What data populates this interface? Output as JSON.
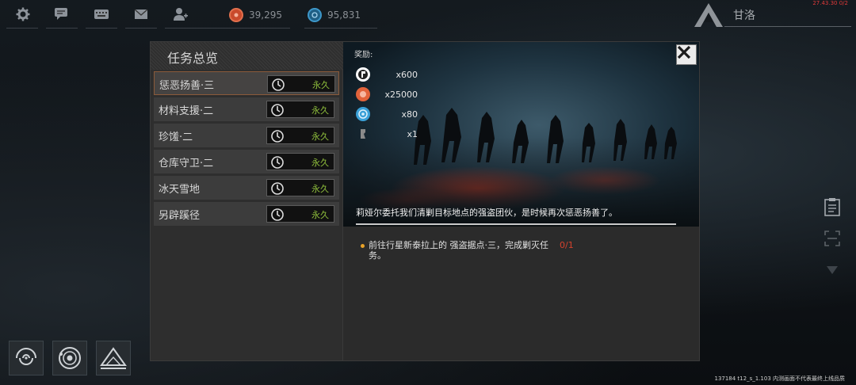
{
  "topbar": {
    "icons": [
      "gear-icon",
      "chat-icon",
      "keyboard-icon",
      "mail-icon",
      "friends-icon"
    ],
    "currency_orange": "39,295",
    "currency_blue": "95,831",
    "player_name": "甘洛",
    "fps": "27.43.30 0/2"
  },
  "quest_list": {
    "title": "任务总览",
    "items": [
      {
        "name": "惩恶扬善·三",
        "duration": "永久"
      },
      {
        "name": "材料支援·二",
        "duration": "永久"
      },
      {
        "name": "珍馐·二",
        "duration": "永久"
      },
      {
        "name": "仓库守卫·二",
        "duration": "永久"
      },
      {
        "name": "冰天雪地",
        "duration": "永久"
      },
      {
        "name": "另辟蹊径",
        "duration": "永久"
      }
    ]
  },
  "detail": {
    "rewards_title": "奖励:",
    "rewards": [
      {
        "icon": "reputation-icon",
        "qty": "x600",
        "color": "#ffffff"
      },
      {
        "icon": "orange-coin-icon",
        "qty": "x25000",
        "color": "#e2633b"
      },
      {
        "icon": "blue-coin-icon",
        "qty": "x80",
        "color": "#3aa0d8"
      },
      {
        "icon": "item-icon",
        "qty": "x1",
        "color": "#8a8a8a"
      }
    ],
    "description": "莉娅尔委托我们清剿目标地点的强盗团伙，是时候再次惩恶扬善了。",
    "objective_text": "前往行星新泰拉上的 强盗据点·三，完成剿灭任务。",
    "objective_progress": "0/1"
  },
  "build_info": "137184 t12_s_1.103  内测画面不代表最终上线品质",
  "colors": {
    "accent_orange": "#e8a228",
    "timer_green": "#8fbf3c",
    "progress_red": "#d6422d"
  }
}
